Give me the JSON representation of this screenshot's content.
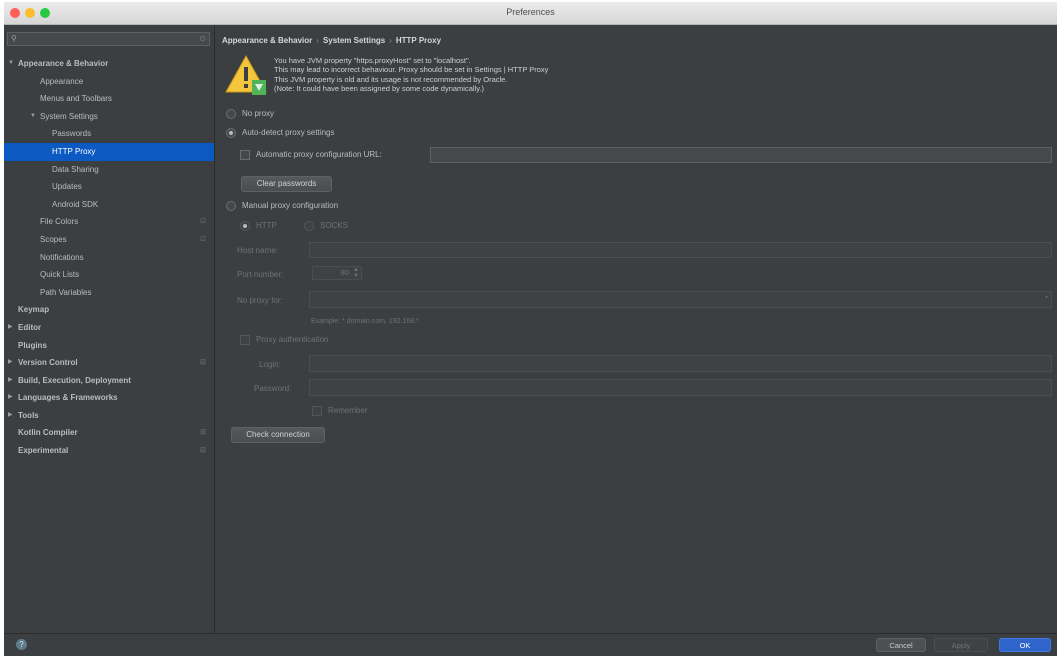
{
  "window": {
    "title": "Preferences"
  },
  "search": {
    "icon": "search-icon",
    "placeholder": "",
    "value": ""
  },
  "sidebar": {
    "items": [
      {
        "label": "Appearance & Behavior",
        "level": 0,
        "expanded": true,
        "bold": true,
        "modified": false,
        "selected": false
      },
      {
        "label": "Appearance",
        "level": 1,
        "modified": false,
        "selected": false
      },
      {
        "label": "Menus and Toolbars",
        "level": 1,
        "modified": false,
        "selected": false
      },
      {
        "label": "System Settings",
        "level": 1,
        "expanded": true,
        "modified": false,
        "selected": false
      },
      {
        "label": "Passwords",
        "level": 2,
        "modified": false,
        "selected": false
      },
      {
        "label": "HTTP Proxy",
        "level": 2,
        "modified": false,
        "selected": true
      },
      {
        "label": "Data Sharing",
        "level": 2,
        "modified": false,
        "selected": false
      },
      {
        "label": "Updates",
        "level": 2,
        "modified": false,
        "selected": false
      },
      {
        "label": "Android SDK",
        "level": 2,
        "modified": false,
        "selected": false
      },
      {
        "label": "File Colors",
        "level": 1,
        "modified": true,
        "selected": false
      },
      {
        "label": "Scopes",
        "level": 1,
        "modified": true,
        "selected": false
      },
      {
        "label": "Notifications",
        "level": 1,
        "modified": false,
        "selected": false
      },
      {
        "label": "Quick Lists",
        "level": 1,
        "modified": false,
        "selected": false
      },
      {
        "label": "Path Variables",
        "level": 1,
        "modified": false,
        "selected": false
      },
      {
        "label": "Keymap",
        "level": 0,
        "bold": true,
        "modified": false,
        "selected": false
      },
      {
        "label": "Editor",
        "level": 0,
        "collapsed": true,
        "bold": true,
        "modified": false,
        "selected": false
      },
      {
        "label": "Plugins",
        "level": 0,
        "bold": true,
        "modified": false,
        "selected": false
      },
      {
        "label": "Version Control",
        "level": 0,
        "collapsed": true,
        "bold": true,
        "modified": true,
        "selected": false
      },
      {
        "label": "Build, Execution, Deployment",
        "level": 0,
        "collapsed": true,
        "bold": true,
        "modified": false,
        "selected": false
      },
      {
        "label": "Languages & Frameworks",
        "level": 0,
        "collapsed": true,
        "bold": true,
        "modified": false,
        "selected": false
      },
      {
        "label": "Tools",
        "level": 0,
        "collapsed": true,
        "bold": true,
        "modified": false,
        "selected": false
      },
      {
        "label": "Kotlin Compiler",
        "level": 0,
        "bold": true,
        "modified": true,
        "selected": false
      },
      {
        "label": "Experimental",
        "level": 0,
        "bold": true,
        "modified": true,
        "selected": false
      }
    ]
  },
  "breadcrumb": {
    "items": [
      "Appearance & Behavior",
      "System Settings",
      "HTTP Proxy"
    ],
    "separator": "›"
  },
  "warning": {
    "icon": "warning-icon",
    "lines": [
      "You have JVM property \"https.proxyHost\" set to \"localhost\".",
      "This may lead to incorrect behaviour. Proxy should be set in Settings | HTTP Proxy",
      "This JVM property is old and its usage is not recommended by Oracle.",
      "(Note: It could have been assigned by some code dynamically.)"
    ]
  },
  "proxy": {
    "no_proxy_label": "No proxy",
    "no_proxy_selected": false,
    "auto_detect_label": "Auto-detect proxy settings",
    "auto_detect_selected": true,
    "auto_config_url_label": "Automatic proxy configuration URL:",
    "auto_config_url_checked": false,
    "auto_config_url_value": "",
    "clear_passwords_label": "Clear passwords",
    "manual_label": "Manual proxy configuration",
    "manual_selected": false,
    "http_label": "HTTP",
    "socks_label": "SOCKS",
    "host_name_label": "Host name:",
    "host_name_value": "",
    "port_label": "Port number:",
    "port_value": "80",
    "no_proxy_for_label": "No proxy for:",
    "no_proxy_for_value": "",
    "example_text": "Example: *.domain.com, 192.168.*",
    "proxy_auth_label": "Proxy authentication",
    "login_label": "Login:",
    "login_value": "",
    "password_label": "Password:",
    "password_value": "",
    "remember_label": "Remember",
    "check_connection_label": "Check connection"
  },
  "footer": {
    "help_icon": "help-icon",
    "cancel_label": "Cancel",
    "apply_label": "Apply",
    "ok_label": "OK"
  },
  "colors": {
    "background": "#3c3f41",
    "selection": "#0d59c2",
    "text": "#bbbbbb",
    "disabled_text": "#6f7274",
    "accent_button": "#2f65ca"
  }
}
